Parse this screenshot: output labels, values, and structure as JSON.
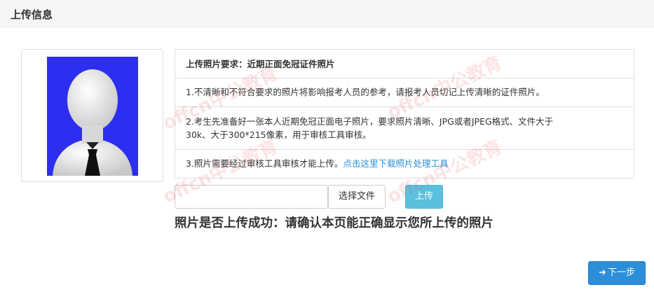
{
  "header": {
    "title": "上传信息"
  },
  "requirements": {
    "title": "上传照片要求：近期正面免冠证件照片",
    "item1": "1.不清晰和不符合要求的照片将影响报考人员的参考，请报考人员切记上传清晰的证件照片。",
    "item2_line1": "2.考生先准备好一张本人近期免冠正面电子照片，要求照片清晰、JPG或者JPEG格式、文件大于",
    "item2_line2": "30k、大于300*215像素，用于审核工具审核。",
    "item3_text": "3.照片需要经过审核工具审核才能上传。",
    "item3_link": "点击这里下载照片处理工具"
  },
  "upload": {
    "file_value": "",
    "choose_label": "选择文件",
    "upload_label": "上传",
    "status_text": "照片是否上传成功：请确认本页能正确显示您所上传的照片"
  },
  "footer": {
    "next_label": "下一步",
    "next_icon": "arrow-right-icon"
  },
  "watermark": {
    "text": "offcn中公教育"
  },
  "colors": {
    "photo_bg": "#2e2ef0",
    "upload_btn": "#5bc0de",
    "next_btn": "#2b8ed8",
    "link": "#2a8fd8"
  }
}
